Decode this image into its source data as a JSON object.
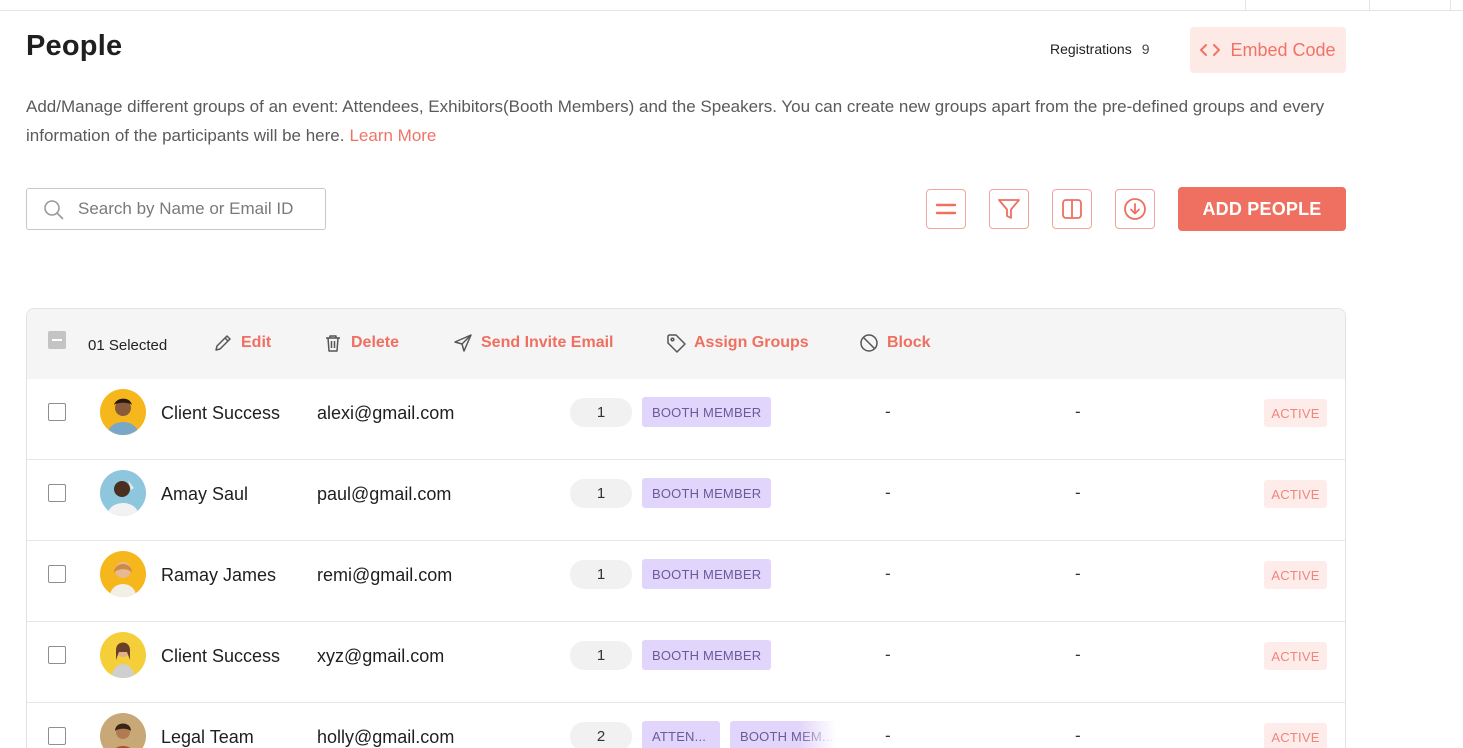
{
  "header": {
    "title": "People",
    "registrations_label": "Registrations",
    "registrations_count": "9",
    "embed_label": "Embed Code"
  },
  "description": {
    "text": "Add/Manage different groups of an event: Attendees, Exhibitors(Booth Members) and the Speakers. You can create new groups apart from the pre-defined groups and every information of the participants will be here.",
    "learn_more": "Learn More"
  },
  "toolbar": {
    "search_placeholder": "Search by Name or Email ID",
    "add_label": "ADD PEOPLE",
    "icons": [
      "equals-icon",
      "filter-icon",
      "columns-icon",
      "download-icon"
    ]
  },
  "bulk": {
    "selected": "01 Selected",
    "edit": "Edit",
    "delete": "Delete",
    "send_invite": "Send Invite Email",
    "assign_groups": "Assign Groups",
    "block": "Block"
  },
  "colors": {
    "accent": "#ef6f60",
    "tag_bg": "#e2d5fb",
    "status_bg": "#fdecea"
  },
  "rows": [
    {
      "name": "Client Success",
      "email": "alexi@gmail.com",
      "count": "1",
      "tags": [
        "BOOTH MEMBER"
      ],
      "col1": "-",
      "col2": "-",
      "status": "ACTIVE"
    },
    {
      "name": "Amay Saul",
      "email": "paul@gmail.com",
      "count": "1",
      "tags": [
        "BOOTH MEMBER"
      ],
      "col1": "-",
      "col2": "-",
      "status": "ACTIVE"
    },
    {
      "name": "Ramay James",
      "email": "remi@gmail.com",
      "count": "1",
      "tags": [
        "BOOTH MEMBER"
      ],
      "col1": "-",
      "col2": "-",
      "status": "ACTIVE"
    },
    {
      "name": "Client Success",
      "email": "xyz@gmail.com",
      "count": "1",
      "tags": [
        "BOOTH MEMBER"
      ],
      "col1": "-",
      "col2": "-",
      "status": "ACTIVE"
    },
    {
      "name": "Legal Team",
      "email": "holly@gmail.com",
      "count": "2",
      "tags": [
        "ATTEN...",
        "BOOTH MEM..."
      ],
      "col1": "-",
      "col2": "-",
      "status": "ACTIVE"
    }
  ]
}
